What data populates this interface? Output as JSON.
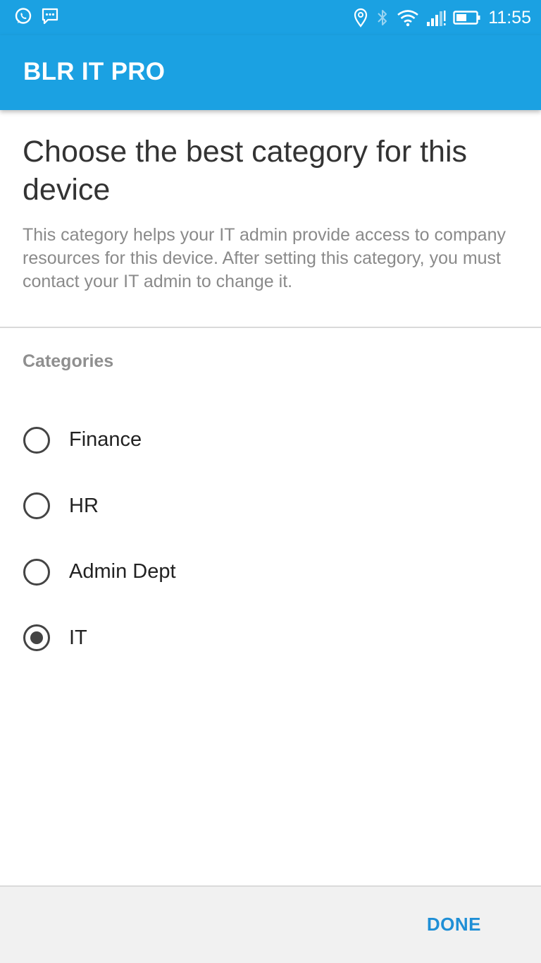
{
  "status_bar": {
    "time": "11:55",
    "left_icons": [
      "whatsapp-icon",
      "message-icon"
    ],
    "right_icons": [
      "location-icon",
      "bluetooth-icon",
      "wifi-icon",
      "signal-icon",
      "battery-icon"
    ]
  },
  "app_bar": {
    "title": "BLR IT PRO"
  },
  "page": {
    "headline": "Choose the best category for this device",
    "description": "This category helps your IT admin provide access to company resources for this device. After setting this category, you must contact your IT admin to change it.",
    "section_label": "Categories"
  },
  "categories": [
    {
      "label": "Finance",
      "selected": false
    },
    {
      "label": "HR",
      "selected": false
    },
    {
      "label": "Admin Dept",
      "selected": false
    },
    {
      "label": "IT",
      "selected": true
    }
  ],
  "footer": {
    "done_label": "DONE"
  },
  "colors": {
    "primary": "#1ba1e2",
    "accent": "#1f8fd6",
    "headline_text": "#333333",
    "secondary_text": "#8a8a8a"
  }
}
